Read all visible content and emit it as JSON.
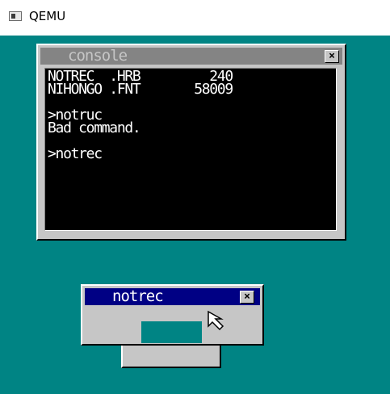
{
  "app": {
    "title": "QEMU",
    "icon": "qemu-window-icon"
  },
  "colors": {
    "desktop": "#008484",
    "window_bg": "#c6c6c6",
    "active_title": "#000084",
    "inactive_title": "#848484",
    "console_bg": "#000000"
  },
  "console": {
    "title": "console",
    "close_label": "×",
    "lines": [
      "NOTREC  .HRB         240",
      "NIHONGO .FNT       58009",
      "",
      ">notruc",
      "Bad command.",
      "",
      ">notrec"
    ]
  },
  "notrec": {
    "title": "notrec",
    "close_label": "×"
  },
  "cursor": {
    "icon": "mouse-pointer-icon"
  }
}
